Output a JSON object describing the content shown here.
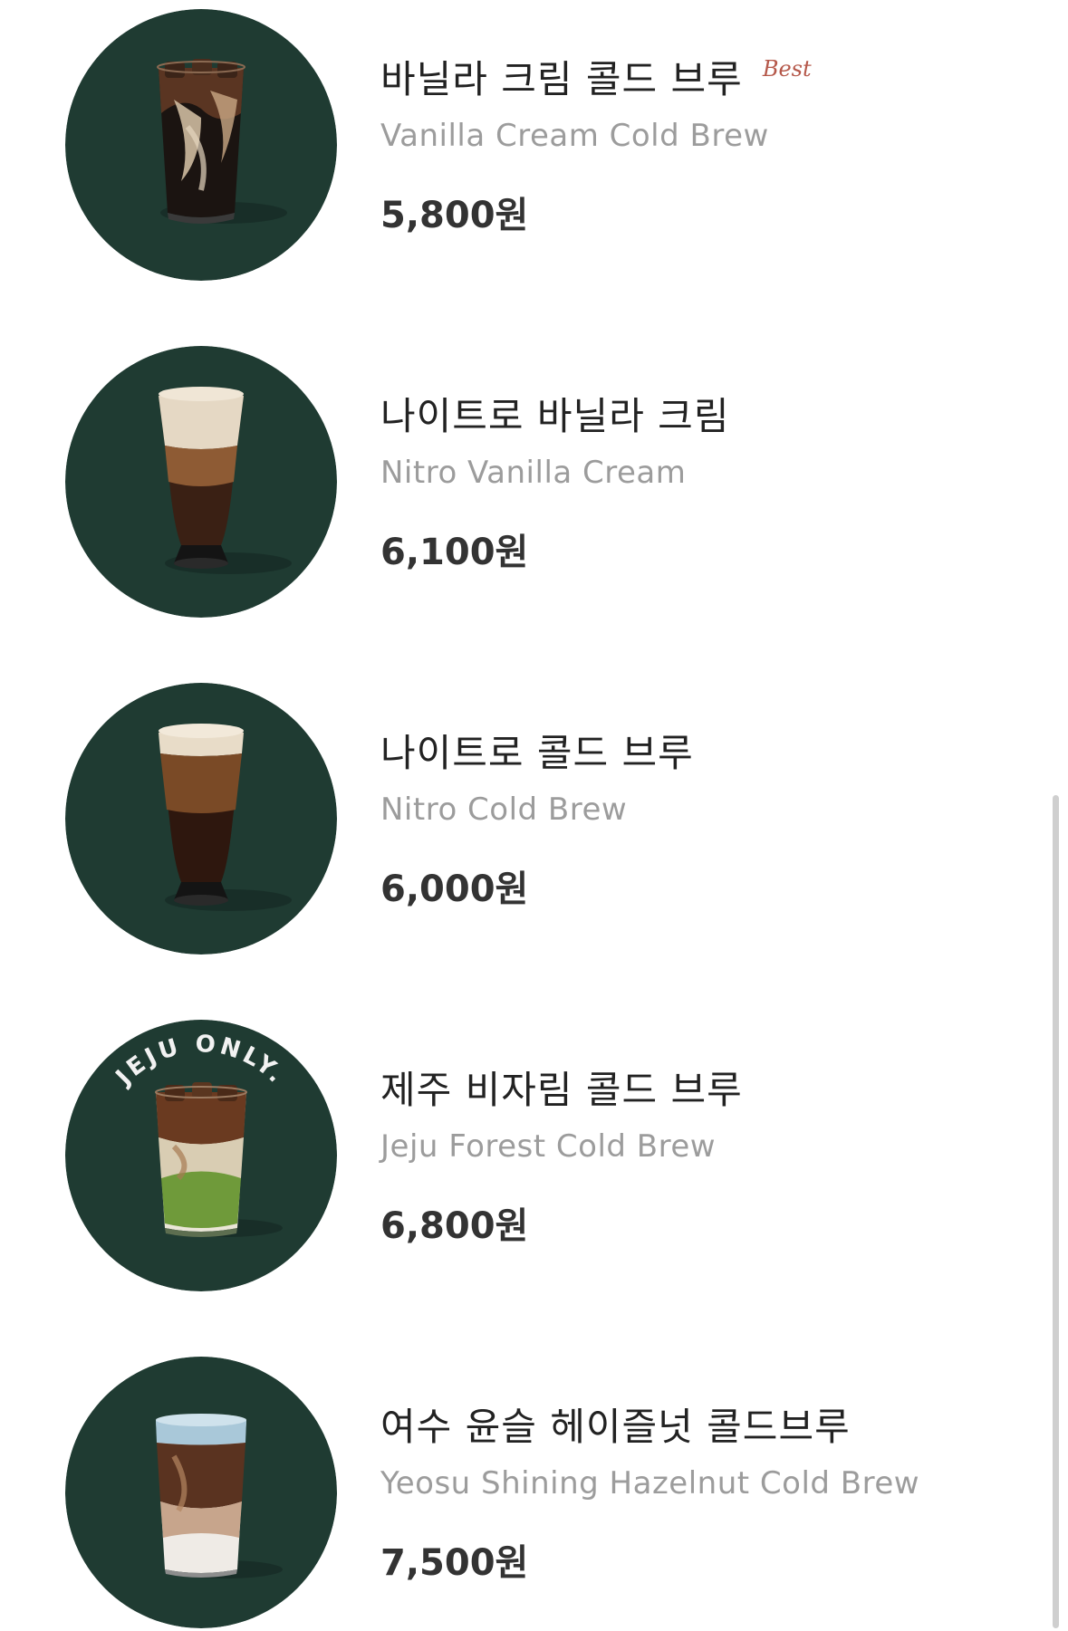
{
  "theme": {
    "circle_color": "#1f3b32",
    "best_color": "#b5584a",
    "title_color": "#222222",
    "subtitle_color": "#9c9c9c"
  },
  "items": [
    {
      "name_kr": "바닐라 크림 콜드 브루",
      "badge": "Best",
      "name_en": "Vanilla Cream Cold Brew",
      "price": "5,800원",
      "image": "iced-cold-brew-with-cream"
    },
    {
      "name_kr": "나이트로 바닐라 크림",
      "name_en": "Nitro Vanilla Cream",
      "price": "6,100원",
      "image": "nitro-pint-glass"
    },
    {
      "name_kr": "나이트로 콜드 브루",
      "name_en": "Nitro Cold Brew",
      "price": "6,000원",
      "image": "nitro-pint-glass"
    },
    {
      "name_kr": "제주 비자림 콜드 브루",
      "name_en": "Jeju Forest Cold Brew",
      "price": "6,800원",
      "image": "layered-green-cold-brew",
      "stamp": "JEJU ONLY."
    },
    {
      "name_kr": "여수 윤슬 헤이즐넛 콜드브루",
      "name_en": "Yeosu Shining Hazelnut Cold Brew",
      "price": "7,500원",
      "image": "blue-foam-layered-cold-brew"
    }
  ]
}
